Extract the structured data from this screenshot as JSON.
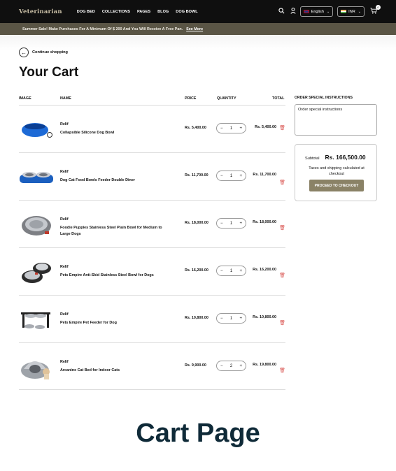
{
  "nav": {
    "logo": "Veterinarian",
    "links": [
      "DOG BED",
      "COLLECTIONS",
      "PAGES",
      "BLOG",
      "DOG BOWL"
    ],
    "language": "English",
    "currency": "INR",
    "cart_count": "0"
  },
  "banner": {
    "text": "Summer Sale! Make Purchases For A Minimum Of $ 200 And You Will Receive A Free Pan.",
    "link": "See More"
  },
  "page": {
    "continue_label": "Continue shopping",
    "title": "Your Cart"
  },
  "table": {
    "headers": {
      "image": "IMAGE",
      "name": "NAME",
      "price": "PRICE",
      "quantity": "QUANTITY",
      "total": "TOTAL"
    },
    "rows": [
      {
        "brand": "Relif",
        "name": "Collapsible Silicone Dog Bowl",
        "price": "Rs. 5,400.00",
        "qty": "1",
        "total": "Rs. 5,400.00"
      },
      {
        "brand": "Relif",
        "name": "Dog Cat Food Bowls Feeder Double Diner",
        "price": "Rs. 11,700.00",
        "qty": "1",
        "total": "Rs. 11,700.00"
      },
      {
        "brand": "Relif",
        "name": "Foodie Puppies Stainless Steel Plain Bowl for Medium to Large Dogs",
        "price": "Rs. 18,000.00",
        "qty": "1",
        "total": "Rs. 18,000.00"
      },
      {
        "brand": "Relif",
        "name": "Pets Empire Anti-Skid Stainless Steel Bowl for Dogs",
        "price": "Rs. 16,200.00",
        "qty": "1",
        "total": "Rs. 16,200.00"
      },
      {
        "brand": "Relif",
        "name": "Pets Empire Pet Feeder for Dog",
        "price": "Rs. 10,800.00",
        "qty": "1",
        "total": "Rs. 10,800.00"
      },
      {
        "brand": "Relif",
        "name": "Arcanine Cat Bed for Indoor Cats",
        "price": "Rs. 9,900.00",
        "qty": "2",
        "total": "Rs. 19,800.00"
      }
    ]
  },
  "sidebar": {
    "special_title": "ORDER SPECIAL INSTRUCTIONS",
    "special_placeholder": "Order special instructions",
    "subtotal_label": "Subtotal",
    "subtotal_value": "Rs. 166,500.00",
    "tax_note": "Taxes and shipping calculated at checkout",
    "checkout_label": "PROCEED TO CHECKOUT"
  },
  "caption": "Cart Page",
  "icons": [
    "search-icon",
    "user-icon",
    "cart-icon",
    "arrow-left-icon",
    "trash-icon"
  ]
}
